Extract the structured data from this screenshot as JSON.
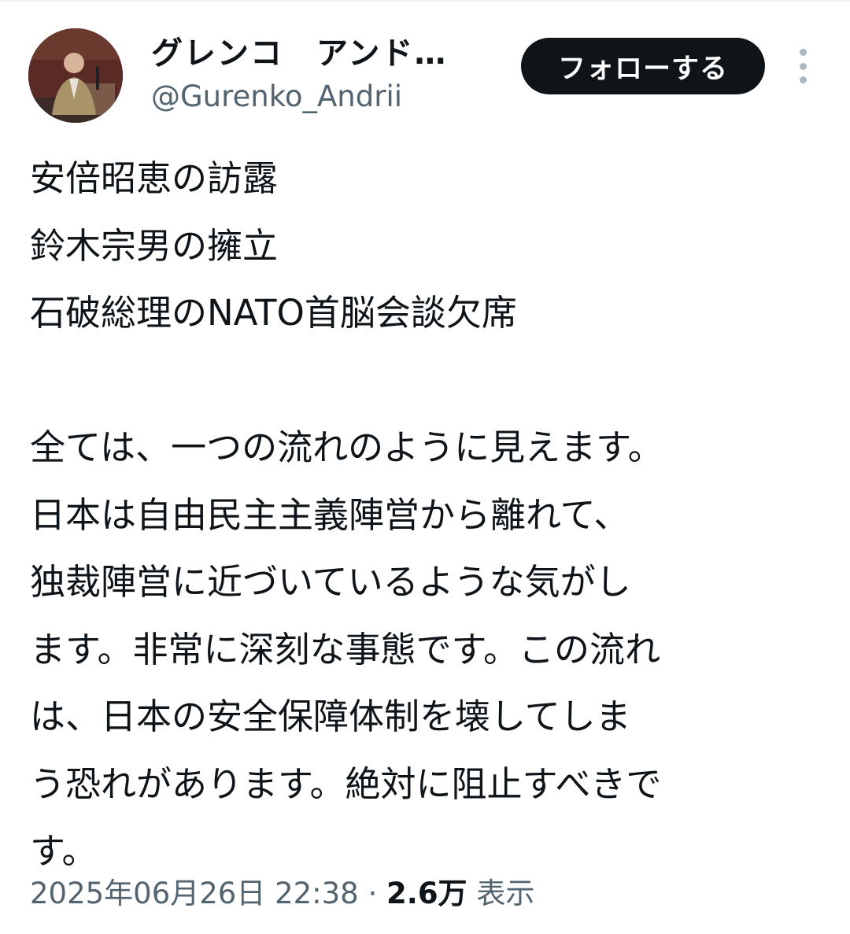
{
  "author": {
    "display_name": "グレンコ　アンド…",
    "handle": "@Gurenko_Andrii"
  },
  "actions": {
    "follow_label": "フォローする",
    "more_icon": "more-vertical-icon"
  },
  "tweet": {
    "lines": [
      "安倍昭恵の訪露",
      "鈴木宗男の擁立",
      "石破総理のNATO首脳会談欠席",
      "",
      "全ては、一つの流れのように見えます。",
      "日本は自由民主主義陣営から離れて、",
      "独裁陣営に近づいているような気がし",
      "ます。非常に深刻な事態です。この流れ",
      "は、日本の安全保障体制を壊してしま",
      "う恐れがあります。絶対に阻止すべきで",
      "す。"
    ]
  },
  "meta": {
    "timestamp": "2025年06月26日 22:38",
    "separator": "·",
    "views_count": "2.6万",
    "views_label": "表示"
  },
  "colors": {
    "text_primary": "#0f1419",
    "text_secondary": "#536471",
    "follow_bg": "#0f1419",
    "follow_text": "#ffffff"
  }
}
